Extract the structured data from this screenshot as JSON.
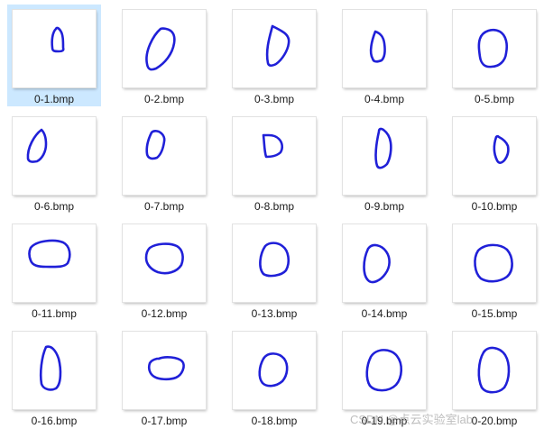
{
  "colors": {
    "stroke": "#2020d8",
    "selected_bg": "#cce8ff"
  },
  "files": [
    {
      "name": "0-1.bmp",
      "icon": "digit-zero-thumbnail",
      "selected": true
    },
    {
      "name": "0-2.bmp",
      "icon": "digit-zero-thumbnail"
    },
    {
      "name": "0-3.bmp",
      "icon": "digit-zero-thumbnail"
    },
    {
      "name": "0-4.bmp",
      "icon": "digit-zero-thumbnail"
    },
    {
      "name": "0-5.bmp",
      "icon": "digit-zero-thumbnail"
    },
    {
      "name": "0-6.bmp",
      "icon": "digit-zero-thumbnail"
    },
    {
      "name": "0-7.bmp",
      "icon": "digit-zero-thumbnail"
    },
    {
      "name": "0-8.bmp",
      "icon": "digit-zero-thumbnail"
    },
    {
      "name": "0-9.bmp",
      "icon": "digit-zero-thumbnail"
    },
    {
      "name": "0-10.bmp",
      "icon": "digit-zero-thumbnail"
    },
    {
      "name": "0-11.bmp",
      "icon": "digit-zero-thumbnail"
    },
    {
      "name": "0-12.bmp",
      "icon": "digit-zero-thumbnail"
    },
    {
      "name": "0-13.bmp",
      "icon": "digit-zero-thumbnail"
    },
    {
      "name": "0-14.bmp",
      "icon": "digit-zero-thumbnail"
    },
    {
      "name": "0-15.bmp",
      "icon": "digit-zero-thumbnail"
    },
    {
      "name": "0-16.bmp",
      "icon": "digit-zero-thumbnail"
    },
    {
      "name": "0-17.bmp",
      "icon": "digit-zero-thumbnail"
    },
    {
      "name": "0-18.bmp",
      "icon": "digit-zero-thumbnail"
    },
    {
      "name": "0-19.bmp",
      "icon": "digit-zero-thumbnail"
    },
    {
      "name": "0-20.bmp",
      "icon": "digit-zero-thumbnail"
    }
  ],
  "watermark": "CSDN @点云实验室lab"
}
